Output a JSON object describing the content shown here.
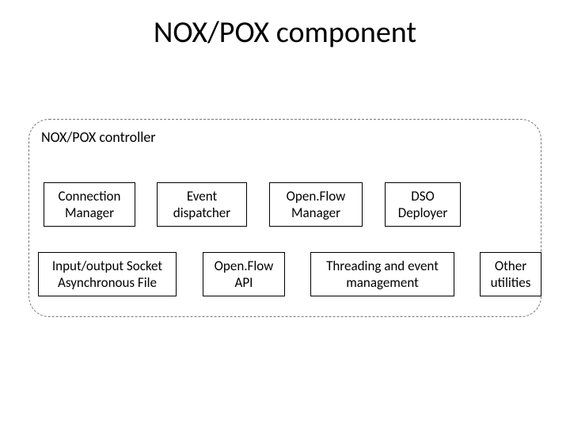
{
  "title": "NOX/POX component",
  "container_label": "NOX/POX controller",
  "row1": {
    "b1": "Connection Manager",
    "b2": "Event dispatcher",
    "b3": "Open.Flow Manager",
    "b4": "DSO Deployer"
  },
  "row2": {
    "b5": "Input/output Socket Asynchronous File",
    "b6": "Open.Flow API",
    "b7": "Threading and event management",
    "b8": "Other utilities"
  }
}
